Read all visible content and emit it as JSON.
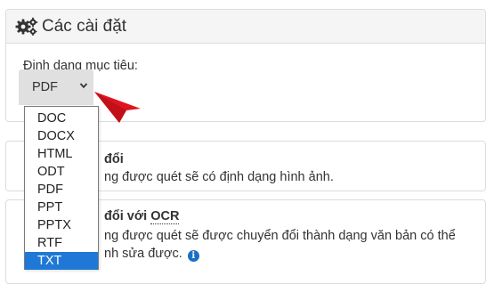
{
  "settings": {
    "title": "Các cài đặt",
    "target_format_label": "Định dạng mục tiêu:",
    "selected_format": "PDF"
  },
  "dropdown": {
    "options": [
      "DOC",
      "DOCX",
      "HTML",
      "ODT",
      "PDF",
      "PPT",
      "PPTX",
      "RTF",
      "TXT"
    ],
    "highlighted": "TXT"
  },
  "conversion_options": {
    "no_ocr": {
      "title_visible": "đổi",
      "description_visible": "ng được quét sẽ có định dạng hình ảnh."
    },
    "ocr": {
      "title_visible_prefix": "đổi với",
      "title_ocr": "OCR",
      "description_line1": "ng được quét sẽ được chuyển đổi thành dạng văn bản có thể",
      "description_line2": "nh sửa được.",
      "info_glyph": "i"
    }
  },
  "colors": {
    "accent_blue": "#1f78d6",
    "pointer_red": "#e0141e"
  }
}
